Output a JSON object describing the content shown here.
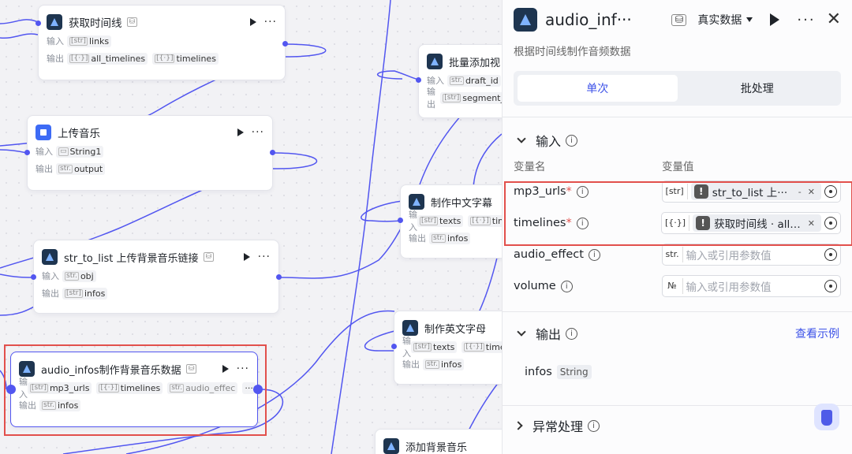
{
  "canvas": {
    "labels": {
      "in": "输入",
      "out": "输出"
    },
    "nodes": {
      "timeline": {
        "title": "获取时间线",
        "inputs": [
          {
            "t": "[str]",
            "v": "links"
          }
        ],
        "outputs": [
          {
            "t": "[{·}]",
            "v": "all_timelines"
          },
          {
            "t": "[{·}]",
            "v": "timelines"
          }
        ]
      },
      "upload": {
        "title": "上传音乐",
        "inputs": [
          {
            "t": "folder",
            "v": "String1"
          }
        ],
        "outputs": [
          {
            "t": "str.",
            "v": "output"
          }
        ]
      },
      "strlist": {
        "title": "str_to_list 上传背景音乐链接",
        "inputs": [
          {
            "t": "str.",
            "v": "obj"
          }
        ],
        "outputs": [
          {
            "t": "[str]",
            "v": "infos"
          }
        ]
      },
      "audio": {
        "title": "audio_infos制作背景音乐数据",
        "inputs": [
          {
            "t": "[str]",
            "v": "mp3_urls"
          },
          {
            "t": "[{·}]",
            "v": "timelines"
          },
          {
            "t": "str.",
            "v": "audio_effec"
          }
        ],
        "outputs": [
          {
            "t": "str.",
            "v": "infos"
          }
        ]
      },
      "batch": {
        "title": "批量添加视",
        "inputs": [
          {
            "t": "str.",
            "v": "draft_id"
          }
        ],
        "outputs": [
          {
            "t": "[str]",
            "v": "segment_"
          }
        ]
      },
      "cnsub": {
        "title": "制作中文字幕",
        "inputs": [
          {
            "t": "[str]",
            "v": "texts"
          },
          {
            "t": "[{·}]",
            "v": "time"
          }
        ],
        "outputs": [
          {
            "t": "str.",
            "v": "infos"
          }
        ]
      },
      "ensub": {
        "title": "制作英文字母",
        "inputs": [
          {
            "t": "[str]",
            "v": "texts"
          },
          {
            "t": "[{·}]",
            "v": "timeli"
          }
        ],
        "outputs": [
          {
            "t": "str.",
            "v": "infos"
          }
        ]
      },
      "bgm": {
        "title": "添加背景音乐"
      }
    }
  },
  "panel": {
    "title": "audio_inf···",
    "mode": "真实数据",
    "description": "根据时间线制作音频数据",
    "tabs": [
      "单次",
      "批处理"
    ],
    "input_section": "输入",
    "col_name": "变量名",
    "col_value": "变量值",
    "params": [
      {
        "name": "mp3_urls",
        "required": "*",
        "type": "[str]",
        "ref": "str_to_list 上···",
        "ref_suffix": "-"
      },
      {
        "name": "timelines",
        "required": "*",
        "type": "[{·}]",
        "ref": "获取时间线 · all_···",
        "ref_suffix": ""
      },
      {
        "name": "audio_effect",
        "required": "",
        "type": "str.",
        "placeholder": "输入或引用参数值"
      },
      {
        "name": "volume",
        "required": "",
        "type": "№",
        "placeholder": "输入或引用参数值"
      }
    ],
    "output_section": "输出",
    "view_example": "查看示例",
    "output": {
      "name": "infos",
      "type": "String"
    },
    "error_section": "异常处理"
  }
}
